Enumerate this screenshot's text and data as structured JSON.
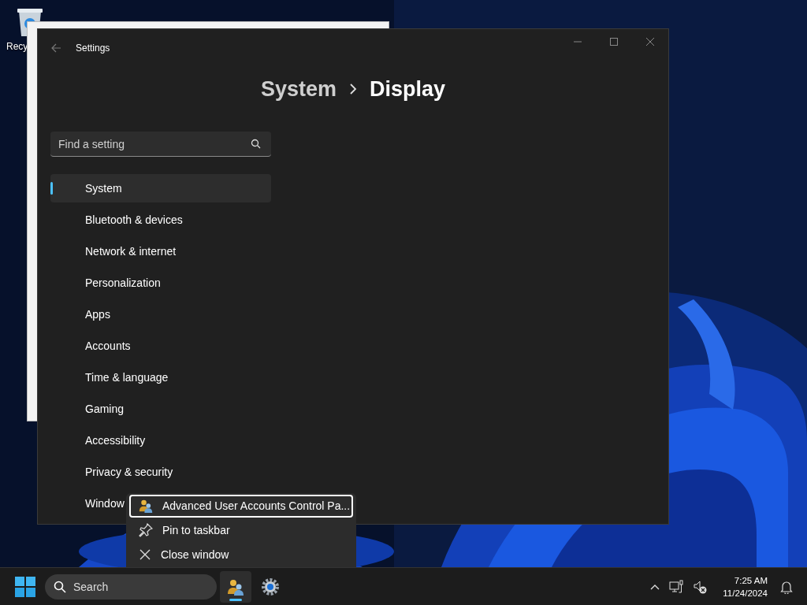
{
  "desktop": {
    "icons": [
      {
        "label": "Recy"
      }
    ]
  },
  "settings_window": {
    "title": "Settings",
    "breadcrumb": {
      "parent": "System",
      "current": "Display"
    },
    "search": {
      "placeholder": "Find a setting"
    },
    "nav_items": [
      {
        "label": "System",
        "selected": true
      },
      {
        "label": "Bluetooth & devices",
        "selected": false
      },
      {
        "label": "Network & internet",
        "selected": false
      },
      {
        "label": "Personalization",
        "selected": false
      },
      {
        "label": "Apps",
        "selected": false
      },
      {
        "label": "Accounts",
        "selected": false
      },
      {
        "label": "Time & language",
        "selected": false
      },
      {
        "label": "Gaming",
        "selected": false
      },
      {
        "label": "Accessibility",
        "selected": false
      },
      {
        "label": "Privacy & security",
        "selected": false
      },
      {
        "label": "Window",
        "selected": false
      }
    ]
  },
  "context_menu": {
    "items": [
      {
        "label": "Advanced User Accounts Control Pa...",
        "kind": "app",
        "selected": true
      },
      {
        "label": "Pin to taskbar",
        "kind": "pin",
        "selected": false
      },
      {
        "label": "Close window",
        "kind": "close",
        "selected": false
      }
    ]
  },
  "taskbar": {
    "search": {
      "placeholder": "Search"
    },
    "apps": [
      {
        "kind": "users",
        "selected": true
      },
      {
        "kind": "settings",
        "selected": false
      }
    ],
    "clock": {
      "time": "7:25 AM",
      "date": "11/24/2024"
    }
  }
}
